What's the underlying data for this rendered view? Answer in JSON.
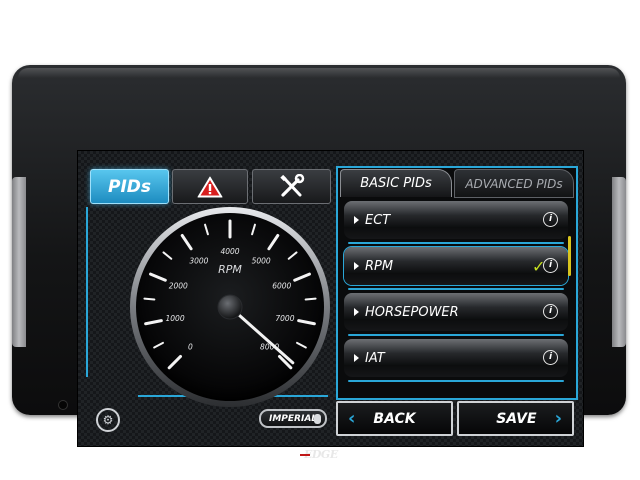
{
  "device": {
    "brand_logo": "EDGE"
  },
  "top_tabs": {
    "pids_label": "PIDs",
    "warning_icon": "warning-triangle",
    "tools_icon": "wrench-screwdriver"
  },
  "gauge": {
    "title": "RPM",
    "ticks": [
      {
        "label": "0",
        "value": 0
      },
      {
        "label": "1000",
        "value": 1000
      },
      {
        "label": "2000",
        "value": 2000
      },
      {
        "label": "3000",
        "value": 3000
      },
      {
        "label": "4000",
        "value": 4000
      },
      {
        "label": "5000",
        "value": 5000
      },
      {
        "label": "6000",
        "value": 6000
      },
      {
        "label": "7000",
        "value": 7000
      },
      {
        "label": "8000",
        "value": 8000
      }
    ],
    "needle_value": 7900,
    "min": 0,
    "max": 8000
  },
  "units_toggle": {
    "label": "IMPERIAL"
  },
  "pid_tabs": {
    "basic_label": "BASIC PIDs",
    "advanced_label": "ADVANCED PIDs"
  },
  "pid_list": [
    {
      "label": "ECT",
      "selected": false
    },
    {
      "label": "RPM",
      "selected": true
    },
    {
      "label": "HORSEPOWER",
      "selected": false
    },
    {
      "label": "IAT",
      "selected": false
    }
  ],
  "buttons": {
    "back_label": "BACK",
    "save_label": "SAVE"
  },
  "colors": {
    "accent": "#2aa7d8",
    "active_tab": "#3ab0e0",
    "checkmark": "#c6e021",
    "bezel": "#151618"
  }
}
